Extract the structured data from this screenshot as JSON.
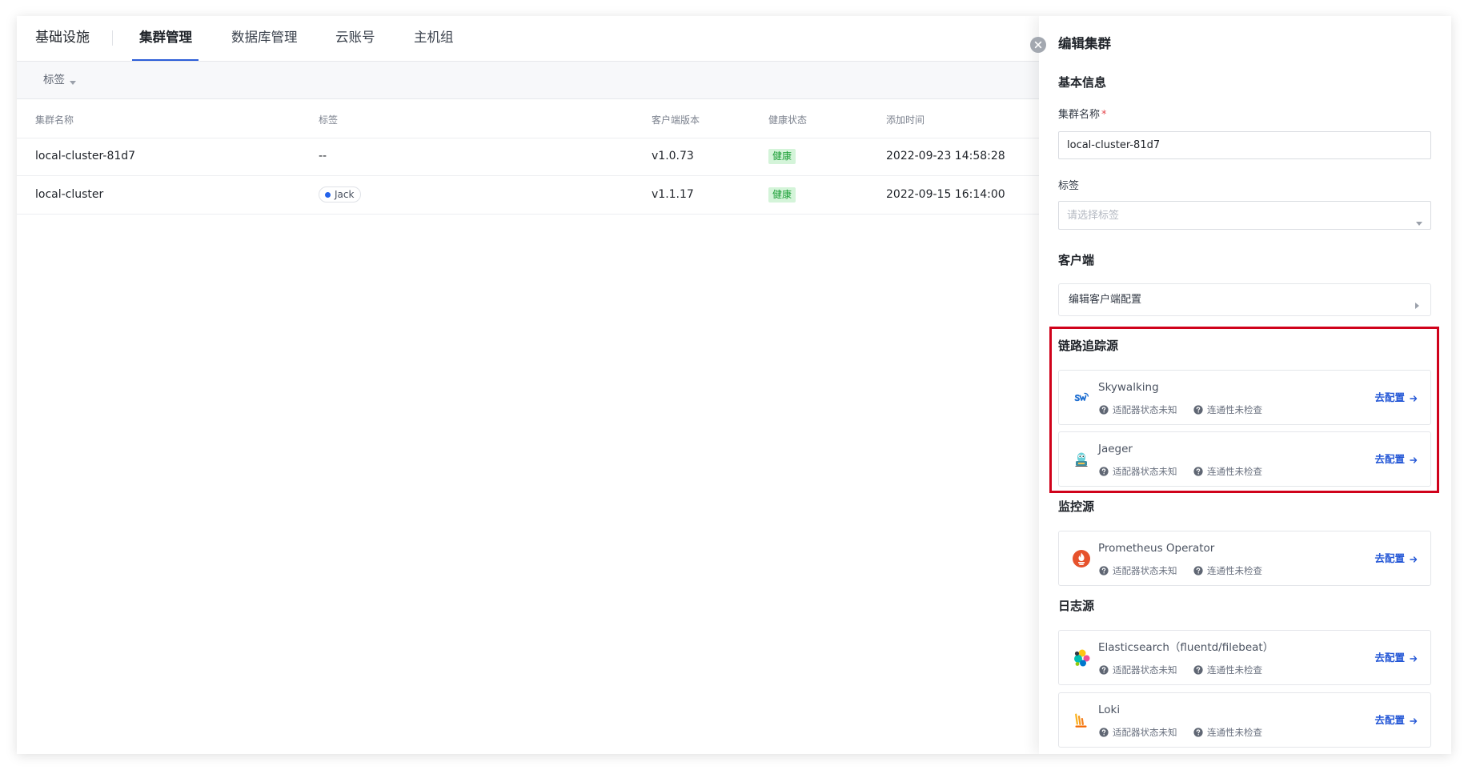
{
  "nav": {
    "brand": "基础设施",
    "tabs": [
      {
        "label": "集群管理",
        "active": true
      },
      {
        "label": "数据库管理",
        "active": false
      },
      {
        "label": "云账号",
        "active": false
      },
      {
        "label": "主机组",
        "active": false
      }
    ]
  },
  "filter": {
    "tag_label": "标签"
  },
  "table": {
    "headers": {
      "name": "集群名称",
      "tag": "标签",
      "version": "客户端版本",
      "health": "健康状态",
      "added": "添加时间"
    },
    "rows": [
      {
        "name": "local-cluster-81d7",
        "tag": "--",
        "version": "v1.0.73",
        "health": "健康",
        "added": "2022-09-23 14:58:28"
      },
      {
        "name": "local-cluster",
        "tag": "Jack",
        "version": "v1.1.17",
        "health": "健康",
        "added": "2022-09-15 16:14:00"
      }
    ]
  },
  "drawer": {
    "title": "编辑集群",
    "basic": {
      "heading": "基本信息",
      "name_label": "集群名称",
      "required_mark": "*",
      "name_value": "local-cluster-81d7",
      "tag_label": "标签",
      "tag_placeholder": "请选择标签"
    },
    "client": {
      "heading": "客户端",
      "config_label": "编辑客户端配置"
    },
    "sections": [
      {
        "heading": "链路追踪源",
        "items": [
          {
            "name": "Skywalking",
            "icon": "skywalking-icon",
            "adapter_status": "适配器状态未知",
            "connectivity_status": "连通性未检查",
            "action": "去配置"
          },
          {
            "name": "Jaeger",
            "icon": "jaeger-icon",
            "adapter_status": "适配器状态未知",
            "connectivity_status": "连通性未检查",
            "action": "去配置"
          }
        ]
      },
      {
        "heading": "监控源",
        "items": [
          {
            "name": "Prometheus Operator",
            "icon": "prometheus-icon",
            "adapter_status": "适配器状态未知",
            "connectivity_status": "连通性未检查",
            "action": "去配置"
          }
        ]
      },
      {
        "heading": "日志源",
        "items": [
          {
            "name": "Elasticsearch（fluentd/filebeat）",
            "icon": "elasticsearch-icon",
            "adapter_status": "适配器状态未知",
            "connectivity_status": "连通性未检查",
            "action": "去配置"
          },
          {
            "name": "Loki",
            "icon": "loki-icon",
            "adapter_status": "适配器状态未知",
            "connectivity_status": "连通性未检查",
            "action": "去配置"
          }
        ]
      }
    ]
  },
  "colors": {
    "accent": "#2c5ed8",
    "action_link": "#2457d6",
    "health_ok_bg": "#d4f4d9",
    "health_ok_text": "#1a9e35",
    "tag_dot": "#2463eb",
    "highlight": "#d0021b",
    "required": "#e5484d"
  }
}
